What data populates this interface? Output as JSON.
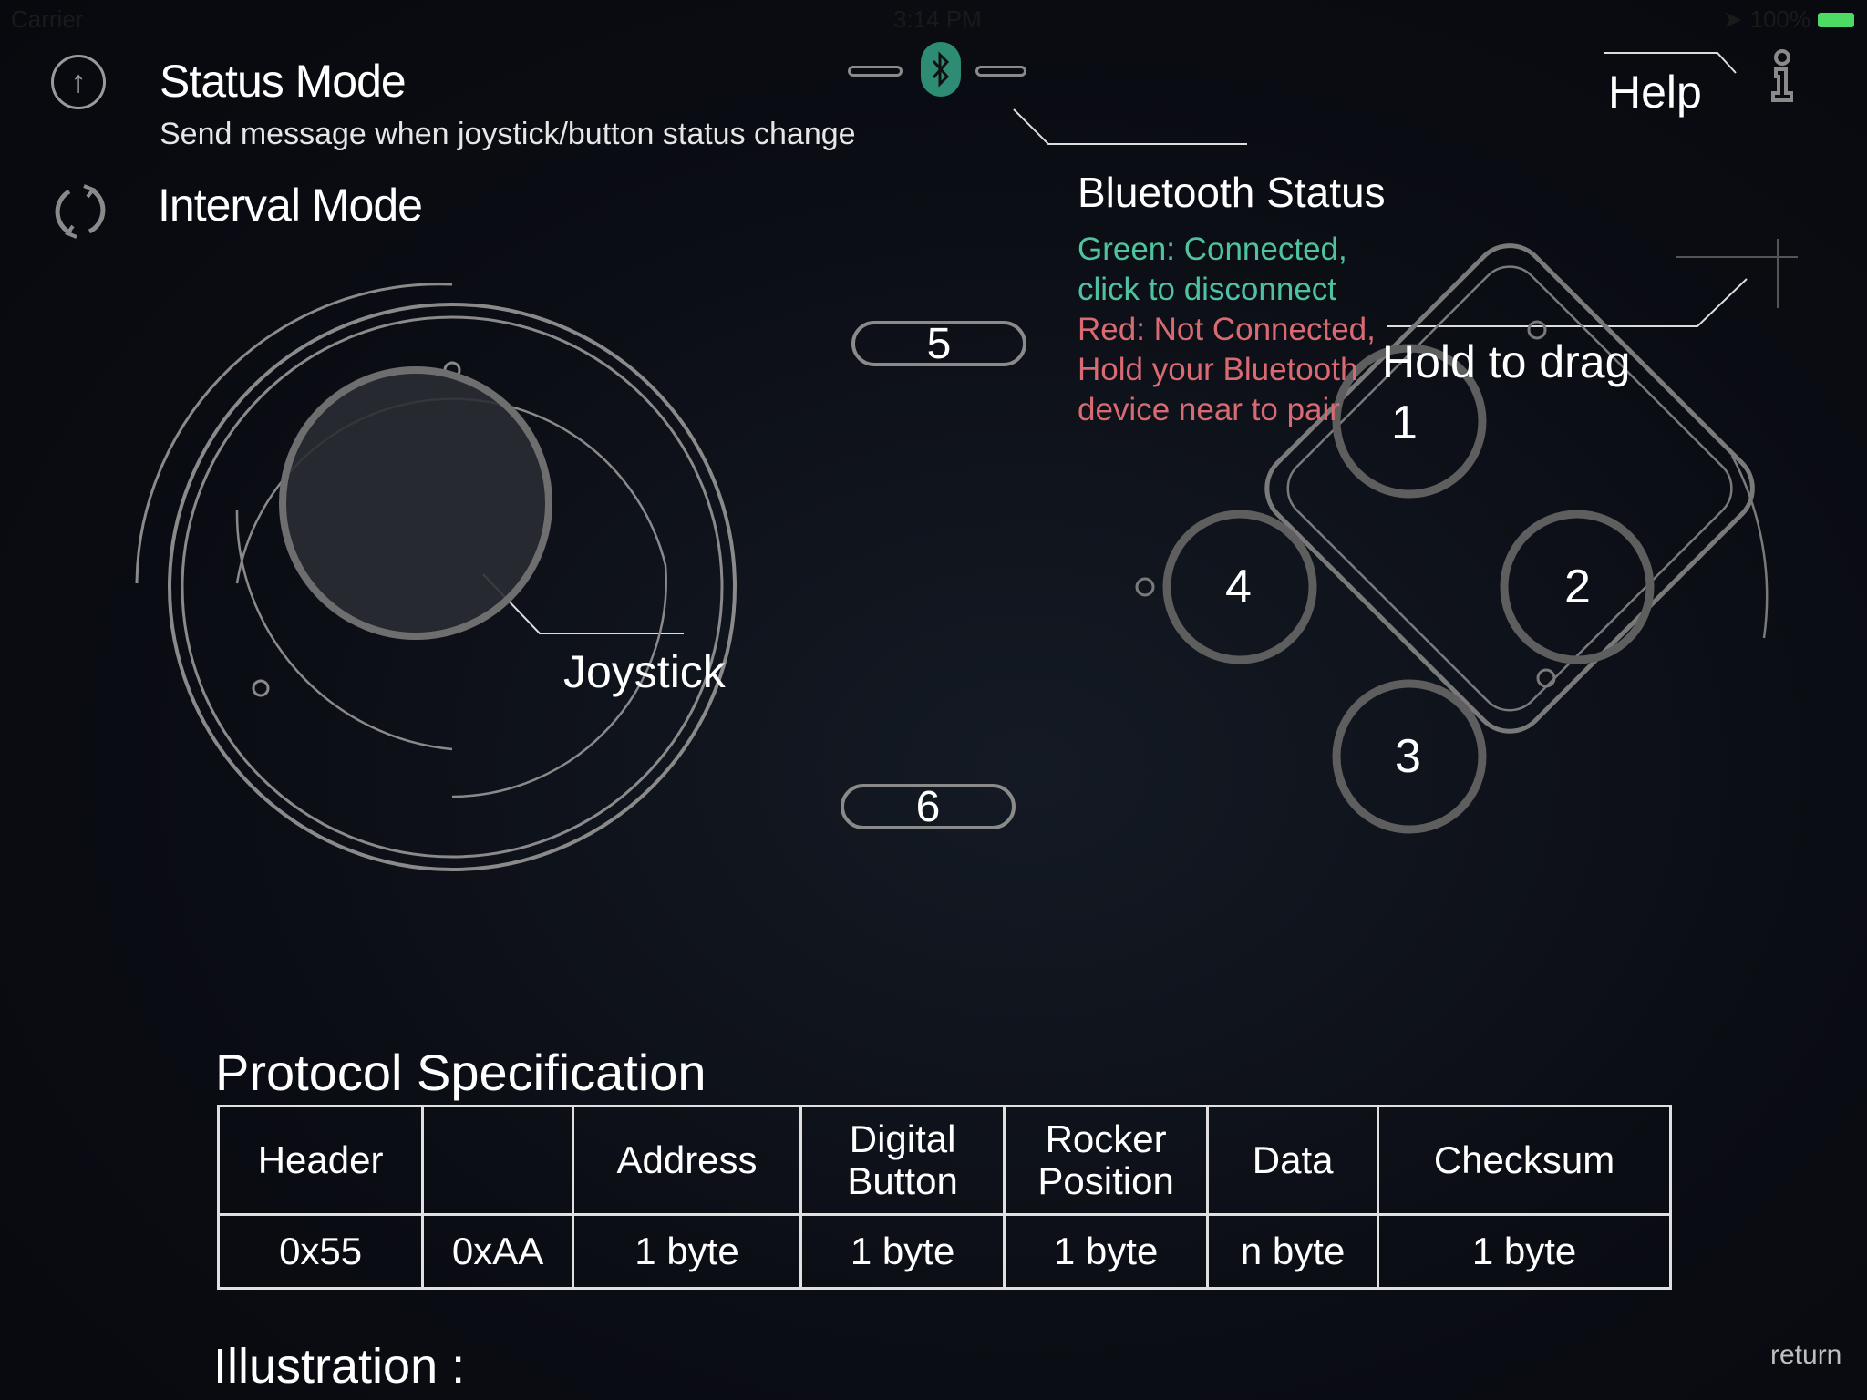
{
  "status_bar": {
    "carrier": "Carrier",
    "time": "3:14 PM",
    "battery": "100%"
  },
  "modes": {
    "status_mode": {
      "title": "Status Mode",
      "description": "Send message when joystick/button status change",
      "icon": "arrow-up-circle-icon"
    },
    "interval_mode": {
      "title": "Interval Mode",
      "icon": "refresh-cycle-icon"
    }
  },
  "bluetooth": {
    "icon": "bluetooth-icon",
    "accent": "#2e8b74",
    "status_title": "Bluetooth Status",
    "green_lines": [
      "Green: Connected,",
      "click to disconnect"
    ],
    "red_lines": [
      "Red: Not Connected,",
      "Hold your Bluetooth",
      "device near to pair"
    ],
    "green_color": "#4fc3a1",
    "red_color": "#d96a72"
  },
  "help": {
    "label": "Help",
    "icon": "info-icon"
  },
  "joystick": {
    "label": "Joystick"
  },
  "buttons": {
    "b5": "5",
    "b6": "6",
    "b1": "1",
    "b2": "2",
    "b3": "3",
    "b4": "4"
  },
  "drag_hint": "Hold to drag",
  "protocol": {
    "title": "Protocol Specification",
    "headers": [
      "Header",
      "",
      "Address",
      "Digital Button",
      "Rocker Position",
      "Data",
      "Checksum"
    ],
    "values": [
      "0x55",
      "0xAA",
      "1 byte",
      "1 byte",
      "1 byte",
      "n byte",
      "1 byte"
    ]
  },
  "illustration_label": "Illustration :",
  "return_label": "return"
}
